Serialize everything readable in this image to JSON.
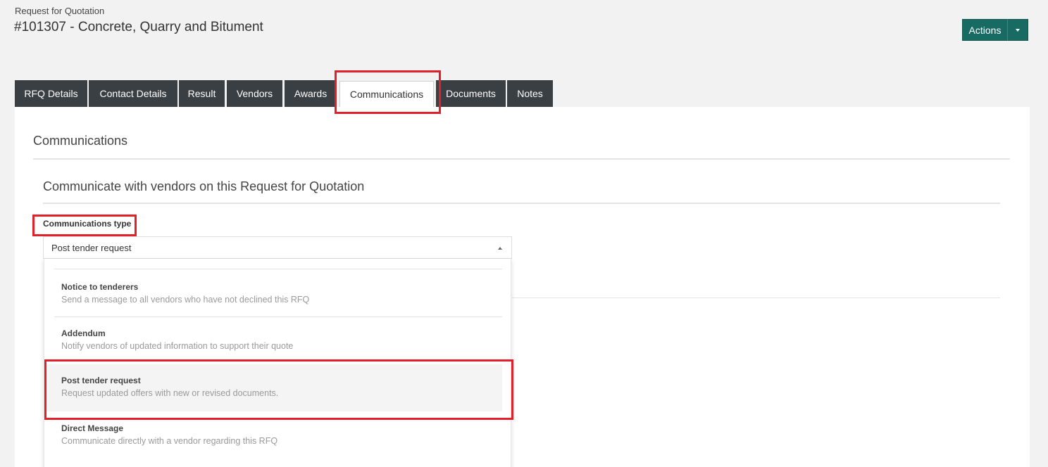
{
  "header": {
    "breadcrumb": "Request for Quotation",
    "title": "#101307 - Concrete, Quarry and Bitument",
    "actions_label": "Actions"
  },
  "tabs": [
    {
      "label": "RFQ Details"
    },
    {
      "label": "Contact Details"
    },
    {
      "label": "Result"
    },
    {
      "label": "Vendors"
    },
    {
      "label": "Awards"
    },
    {
      "label": "Communications",
      "active": true
    },
    {
      "label": "Documents"
    },
    {
      "label": "Notes"
    }
  ],
  "main": {
    "section_title": "Communications",
    "subtitle": "Communicate with vendors on this Request for Quotation",
    "field_label": "Communications type",
    "selected_value": "Post tender request"
  },
  "options": [
    {
      "title": "Notice to tenderers",
      "description": "Send a message to all vendors who have not declined this RFQ"
    },
    {
      "title": "Addendum",
      "description": "Notify vendors of updated information to support their quote"
    },
    {
      "title": "Post tender request",
      "description": "Request updated offers with new or revised documents.",
      "selected": true
    },
    {
      "title": "Direct Message",
      "description": "Communicate directly with a vendor regarding this RFQ"
    }
  ],
  "colors": {
    "accent": "#176b63",
    "tab_dark": "#3a3f44",
    "highlight": "#e0202a"
  }
}
